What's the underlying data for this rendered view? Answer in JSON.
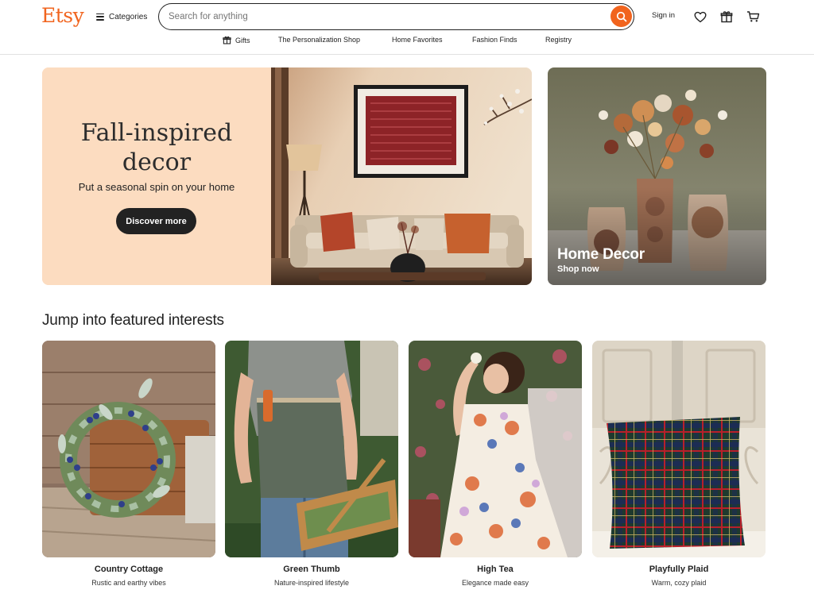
{
  "header": {
    "logo": "Etsy",
    "categories_label": "Categories",
    "search_placeholder": "Search for anything",
    "signin_label": "Sign in"
  },
  "subnav": [
    {
      "label": "Gifts",
      "icon": "gift-icon"
    },
    {
      "label": "The Personalization Shop"
    },
    {
      "label": "Home Favorites"
    },
    {
      "label": "Fashion Finds"
    },
    {
      "label": "Registry"
    }
  ],
  "hero": {
    "title_line1": "Fall-inspired",
    "title_line2": "decor",
    "subtitle": "Put a seasonal spin on your home",
    "button_label": "Discover more"
  },
  "hero_side": {
    "title": "Home Decor",
    "subtitle": "Shop now"
  },
  "featured": {
    "title": "Jump into featured interests",
    "cards": [
      {
        "title": "Country Cottage",
        "subtitle": "Rustic and earthy vibes"
      },
      {
        "title": "Green Thumb",
        "subtitle": "Nature-inspired lifestyle"
      },
      {
        "title": "High Tea",
        "subtitle": "Elegance made easy"
      },
      {
        "title": "Playfully Plaid",
        "subtitle": "Warm, cozy plaid"
      }
    ]
  },
  "colors": {
    "brand": "#f1641e",
    "hero_panel": "#fcdcc0",
    "button_dark": "#222222"
  }
}
